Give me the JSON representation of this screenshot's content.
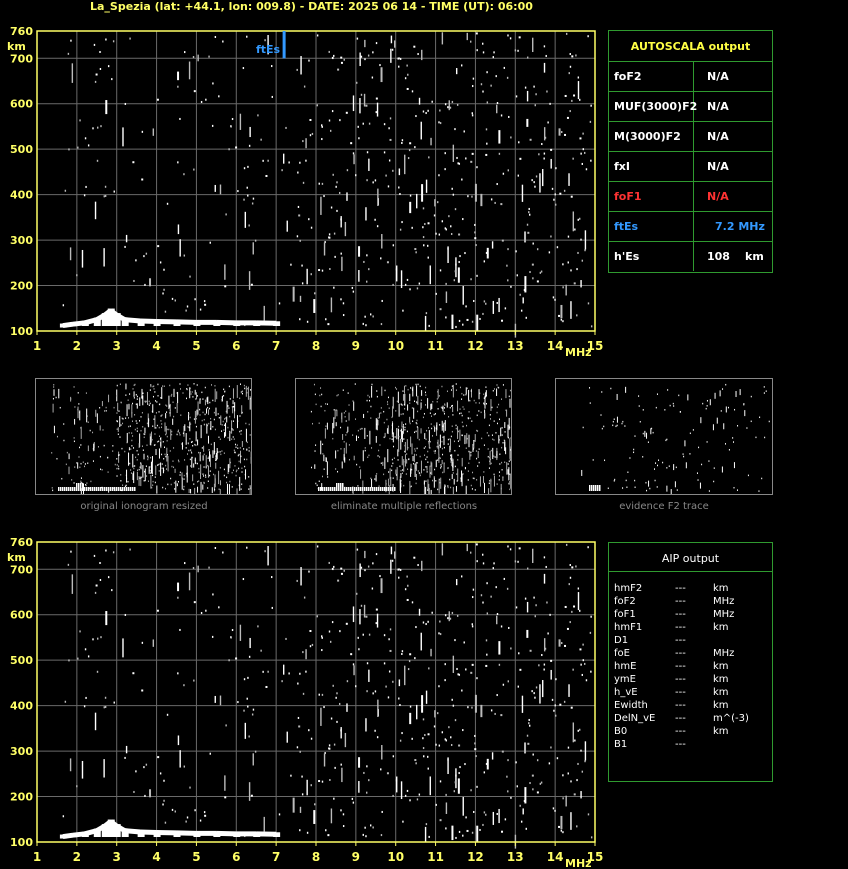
{
  "header": {
    "title": "La_Spezia (lat: +44.1, lon: 009.8) - DATE: 2025 06 14 - TIME (UT): 06:00"
  },
  "chart_data": [
    {
      "type": "scatter",
      "name_hint": "ionogram",
      "ylabel": "km",
      "xlabel": "MHz",
      "xlim": [
        1,
        15
      ],
      "ylim": [
        100,
        760
      ],
      "x_ticks": [
        "1",
        "2",
        "3",
        "4",
        "5",
        "6",
        "7",
        "8",
        "9",
        "10",
        "11",
        "12",
        "13",
        "14",
        "15"
      ],
      "y_ticks": [
        "100",
        "200",
        "300",
        "400",
        "500",
        "600",
        "700",
        "760"
      ],
      "grid": true,
      "annotation": {
        "label": "ftEs",
        "freq": 7.2,
        "h_from": 700,
        "h_to": 760,
        "color": "#3399ff"
      },
      "trace": {
        "color": "#ffffff",
        "points": [
          [
            1.65,
            112
          ],
          [
            1.9,
            115
          ],
          [
            2.2,
            118
          ],
          [
            2.5,
            125
          ],
          [
            2.7,
            135
          ],
          [
            2.85,
            145
          ],
          [
            3.0,
            135
          ],
          [
            3.2,
            125
          ],
          [
            3.6,
            122
          ],
          [
            4.0,
            121
          ],
          [
            4.5,
            120
          ],
          [
            5.0,
            119
          ],
          [
            5.5,
            119
          ],
          [
            6.0,
            118
          ],
          [
            6.5,
            118
          ],
          [
            7.0,
            117
          ]
        ]
      }
    },
    {
      "type": "scatter",
      "ylabel": "km",
      "xlabel": "MHz",
      "xlim": [
        1,
        15
      ],
      "ylim": [
        100,
        760
      ],
      "x_ticks": [
        "1",
        "2",
        "3",
        "4",
        "5",
        "6",
        "7",
        "8",
        "9",
        "10",
        "11",
        "12",
        "13",
        "14",
        "15"
      ],
      "y_ticks": [
        "100",
        "200",
        "300",
        "400",
        "500",
        "600",
        "700",
        "760"
      ],
      "grid": true,
      "trace": {
        "color": "#ffffff",
        "points": [
          [
            1.65,
            112
          ],
          [
            1.9,
            115
          ],
          [
            2.2,
            118
          ],
          [
            2.5,
            125
          ],
          [
            2.7,
            135
          ],
          [
            2.85,
            145
          ],
          [
            3.0,
            135
          ],
          [
            3.2,
            125
          ],
          [
            3.6,
            122
          ],
          [
            4.0,
            121
          ],
          [
            4.5,
            120
          ],
          [
            5.0,
            119
          ],
          [
            5.5,
            119
          ],
          [
            6.0,
            118
          ],
          [
            6.5,
            118
          ],
          [
            7.0,
            117
          ]
        ]
      }
    }
  ],
  "autoscala": {
    "title": "AUTOSCALA output",
    "rows": [
      {
        "label": "foF2",
        "value": "N/A",
        "unit": "",
        "color": "#ffffff",
        "vcolor": "#ffffff"
      },
      {
        "label": "MUF(3000)F2",
        "value": "N/A",
        "unit": "",
        "color": "#ffffff",
        "vcolor": "#ffffff"
      },
      {
        "label": "M(3000)F2",
        "value": "N/A",
        "unit": "",
        "color": "#ffffff",
        "vcolor": "#ffffff"
      },
      {
        "label": "fxI",
        "value": "N/A",
        "unit": "",
        "color": "#ffffff",
        "vcolor": "#ffffff"
      },
      {
        "label": "foF1",
        "value": "N/A",
        "unit": "",
        "color": "#ff3333",
        "vcolor": "#ff3333"
      },
      {
        "label": "ftEs",
        "value": "7.2 MHz",
        "unit": "",
        "color": "#3399ff",
        "vcolor": "#3399ff"
      },
      {
        "label": "h'Es",
        "value": "108",
        "unit": "km",
        "color": "#ffffff",
        "vcolor": "#ffffff"
      }
    ]
  },
  "thumbs": [
    {
      "caption": "original ionogram resized"
    },
    {
      "caption": "eliminate multiple reflections"
    },
    {
      "caption": "evidence F2 trace"
    }
  ],
  "aip": {
    "title": "AIP output",
    "rows": [
      {
        "p": "hmF2",
        "d": "---",
        "u": "km"
      },
      {
        "p": "foF2",
        "d": "---",
        "u": "MHz"
      },
      {
        "p": "foF1",
        "d": "---",
        "u": "MHz"
      },
      {
        "p": "hmF1",
        "d": "---",
        "u": "km"
      },
      {
        "p": "D1",
        "d": "---",
        "u": ""
      },
      {
        "p": "foE",
        "d": "---",
        "u": "MHz"
      },
      {
        "p": "hmE",
        "d": "---",
        "u": "km"
      },
      {
        "p": "ymE",
        "d": "---",
        "u": "km"
      },
      {
        "p": "h_vE",
        "d": "---",
        "u": "km"
      },
      {
        "p": "Ewidth",
        "d": "---",
        "u": "km"
      },
      {
        "p": "DelN_vE",
        "d": "---",
        "u": "m^(-3)"
      },
      {
        "p": "B0",
        "d": "---",
        "u": "km"
      },
      {
        "p": "B1",
        "d": "---",
        "u": ""
      }
    ]
  }
}
